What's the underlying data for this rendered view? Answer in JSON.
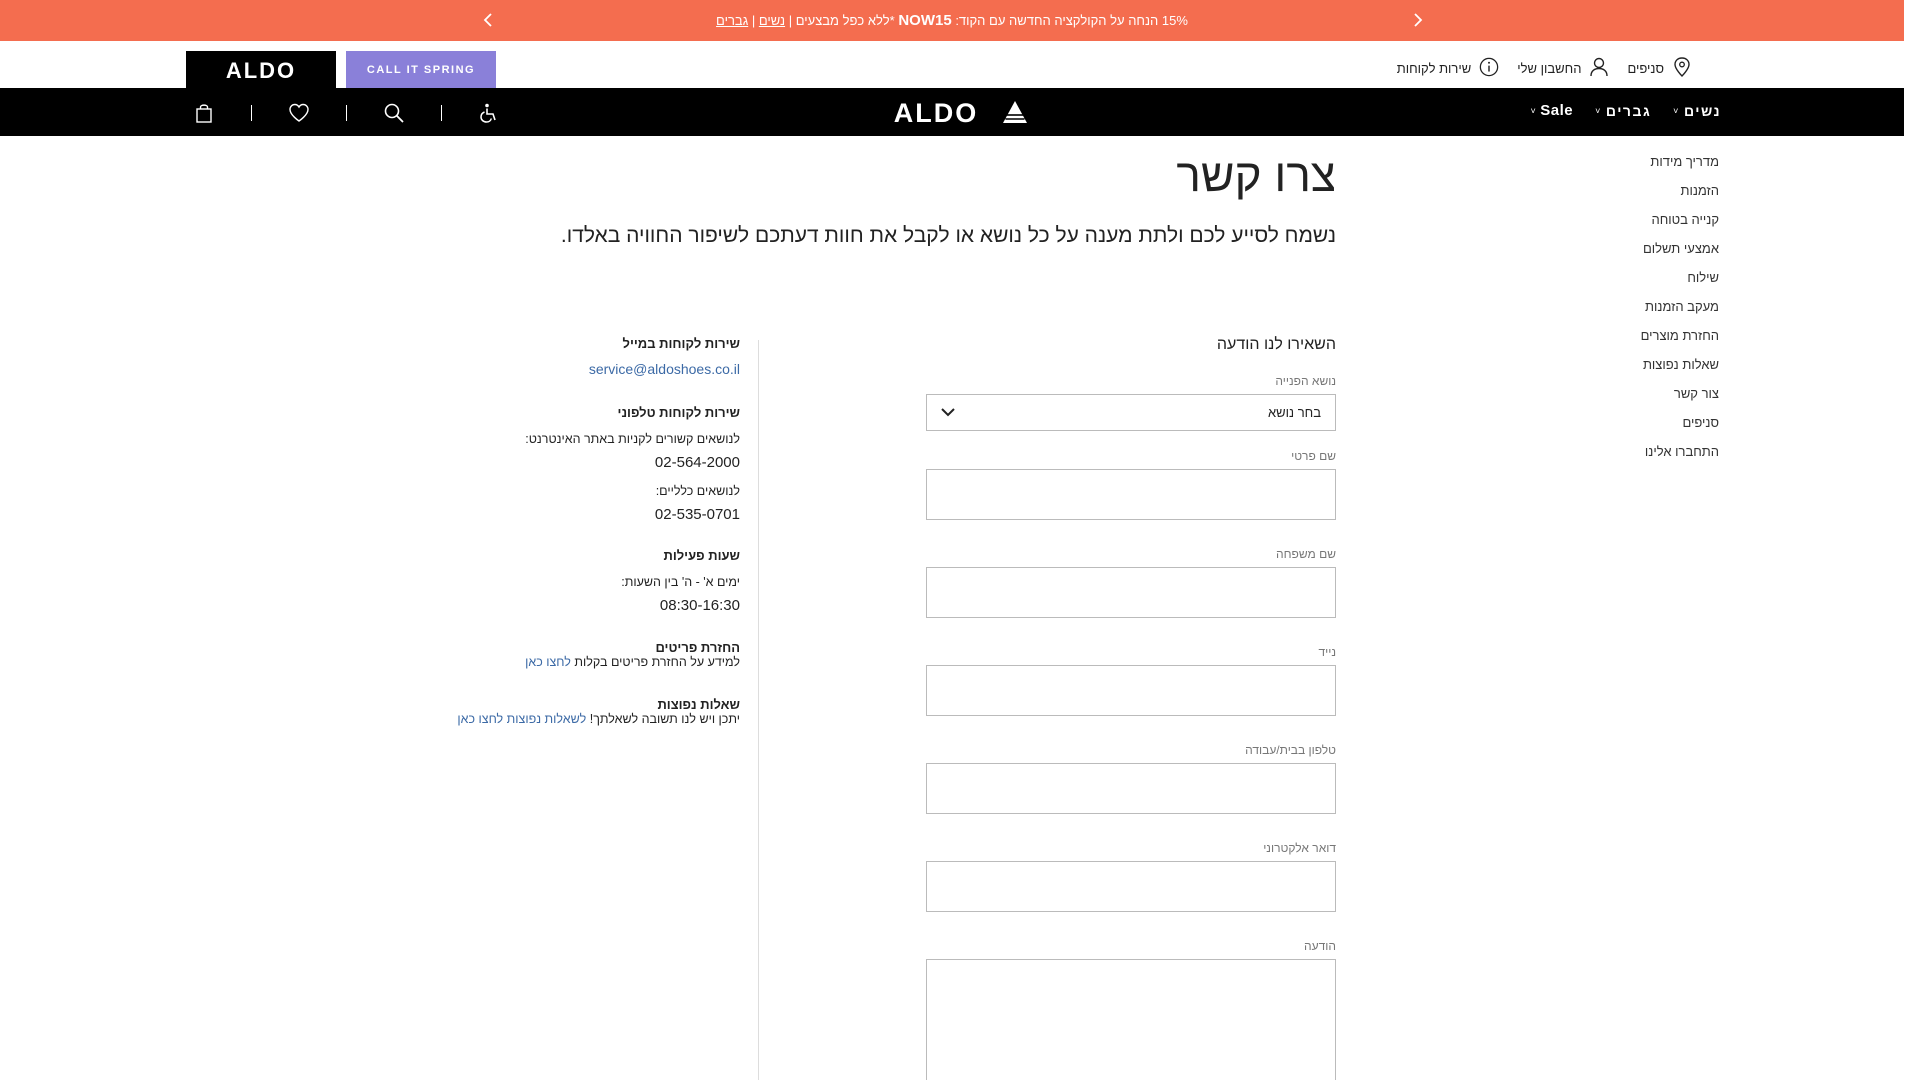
{
  "promo": {
    "text_prefix": "15% הנחה על הקולקציה החדשה עם הקוד:",
    "code": "NOW15",
    "text_suffix": "*ללא כפל מבצעים |",
    "link_women": "נשים",
    "divider": "|",
    "link_men": "גברים",
    "prev_icon": "chevron-left-icon",
    "next_icon": "chevron-right-icon"
  },
  "util": {
    "brand_aldo": "ALDO",
    "brand_spring": "CALL IT SPRING",
    "stores": "סניפים",
    "account": "החשבון שלי",
    "service": "שירות לקוחות"
  },
  "nav": {
    "women": "נשים",
    "men": "גברים",
    "sale": "Sale",
    "logo": "ALDO",
    "icons": [
      "accessibility-icon",
      "search-icon",
      "heart-icon",
      "bag-icon"
    ]
  },
  "side_menu": [
    "מדריך מידות",
    "הזמנות",
    "קנייה בטוחה",
    "אמצעי תשלום",
    "שילוח",
    "מעקב הזמנות",
    "החזרת מוצרים",
    "שאלות נפוצות",
    "צור קשר",
    "סניפים",
    "התחברו אלינו"
  ],
  "page": {
    "title": "צרו קשר",
    "subtitle": "נשמח לסייע לכם ולתת מענה על כל נושא או לקבל את חוות דעתכם לשיפור החוויה באלדו."
  },
  "form": {
    "title": "השאירו לנו הודעה",
    "subject_label": "נושא הפנייה",
    "subject_value": "בחר נושא",
    "first_name_label": "שם פרטי",
    "last_name_label": "שם משפחה",
    "mobile_label": "נייד",
    "phone_label": "טלפון בבית/עבודה",
    "email_label": "דואר אלקטרוני",
    "message_label": "הודעה"
  },
  "info": {
    "email_heading": "שירות לקוחות במייל",
    "email": "service@aldoshoes.co.il",
    "phone_heading": "שירות לקוחות טלפוני",
    "online_label": "לנושאים קשורים לקניות באתר האינטרנט:",
    "online_phone": "02-564-2000",
    "general_label": "לנושאים כלליים:",
    "general_phone": "02-535-0701",
    "hours_heading": "שעות פעילות",
    "hours_label": "ימים א' - ה' בין השעות:",
    "hours": "08:30-16:30",
    "returns_heading": "החזרת פריטים",
    "returns_text": "למידע על החזרת פריטים בקלות",
    "returns_link": "לחצו כאן",
    "faq_heading": "שאלות נפוצות",
    "faq_text": "יתכן ויש לנו תשובה לשאלתך!",
    "faq_link": "לשאלות נפוצות לחצו כאן"
  }
}
